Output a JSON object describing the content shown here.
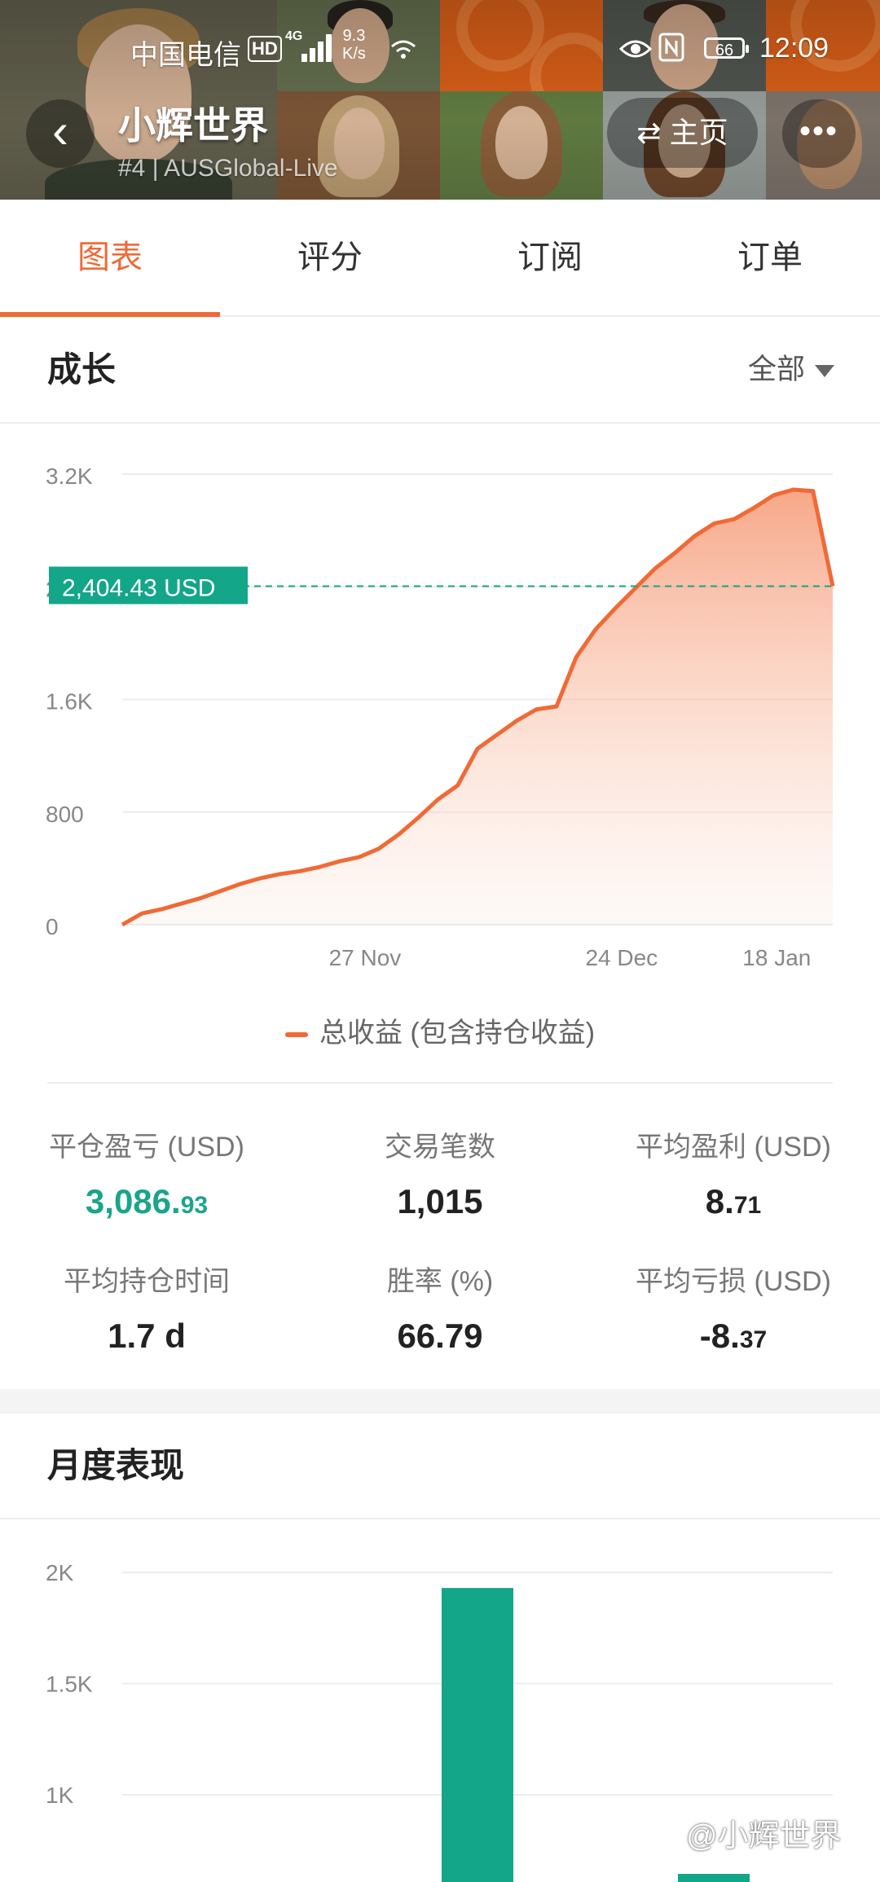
{
  "status_bar": {
    "carrier": "中国电信",
    "hd_badge": "HD",
    "network": "4G",
    "speed_value": "9.3",
    "speed_unit": "K/s",
    "battery": "66",
    "time": "12:09"
  },
  "header": {
    "title": "小辉世界",
    "subtitle": "#4 | AUSGlobal-Live",
    "home_label": "主页",
    "back_icon": "chevron-left-icon",
    "more_icon": "more-dots-icon",
    "accent_color": "#f26a1b"
  },
  "tabs": [
    {
      "label": "图表",
      "active": true
    },
    {
      "label": "评分",
      "active": false
    },
    {
      "label": "订阅",
      "active": false
    },
    {
      "label": "订单",
      "active": false
    }
  ],
  "growth": {
    "title": "成长",
    "filter_label": "全部"
  },
  "chart_data": [
    {
      "type": "area",
      "series": [
        {
          "name": "总收益 (包含持仓收益)",
          "color": "#f06a36",
          "y": [
            0,
            80,
            110,
            150,
            190,
            240,
            290,
            330,
            360,
            380,
            410,
            450,
            480,
            540,
            640,
            760,
            890,
            990,
            1250,
            1350,
            1450,
            1530,
            1550,
            1900,
            2100,
            2250,
            2390,
            2530,
            2640,
            2760,
            2850,
            2880,
            2960,
            3050,
            3090,
            3080,
            2404.43
          ]
        }
      ],
      "x_ticks": [
        "27 Nov",
        "24 Dec",
        "18 Jan"
      ],
      "x_tick_index": [
        12.3,
        25.3,
        34.9
      ],
      "y_ticks": [
        "0",
        "800",
        "1.6K",
        "2.4K",
        "3.2K"
      ],
      "y_tick_values": [
        0,
        800,
        1600,
        2400,
        3200
      ],
      "ylim": [
        0,
        3200
      ],
      "current_value": 2404.43,
      "current_label": "2,404.43 USD",
      "marker_color": "#13a689",
      "legend": "bottom",
      "grid": true
    },
    {
      "type": "bar",
      "color": "#13a689",
      "y_ticks": [
        "1K",
        "1.5K",
        "2K"
      ],
      "y_tick_values": [
        1000,
        1500,
        2000
      ],
      "visible_bars": [
        {
          "value": 1930
        },
        {
          "value": 0
        }
      ]
    }
  ],
  "stats": [
    {
      "label": "平仓盈亏 (USD)",
      "value_main": "3,086.",
      "value_small": "93",
      "highlight": true
    },
    {
      "label": "交易笔数",
      "value_main": "1,015",
      "value_small": "",
      "highlight": false
    },
    {
      "label": "平均盈利 (USD)",
      "value_main": "8.",
      "value_small": "71",
      "highlight": false
    },
    {
      "label": "平均持仓时间",
      "value_main": "1.7 d",
      "value_small": "",
      "highlight": false
    },
    {
      "label": "胜率 (%)",
      "value_main": "66.79",
      "value_small": "",
      "highlight": false
    },
    {
      "label": "平均亏损 (USD)",
      "value_main": "-8.",
      "value_small": "37",
      "highlight": false
    }
  ],
  "monthly": {
    "title": "月度表现"
  },
  "watermark": "@小辉世界"
}
